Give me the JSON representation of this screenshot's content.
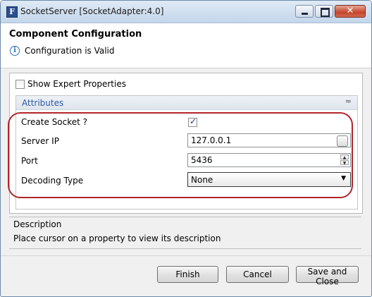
{
  "window": {
    "title": "SocketServer [SocketAdapter:4.0]",
    "app_icon_letter": "F",
    "controls": {
      "minimize": "minimize",
      "maximize": "maximize",
      "close": "✕"
    }
  },
  "header": {
    "title": "Component Configuration",
    "status": "Configuration is Valid",
    "info_icon": "i"
  },
  "config": {
    "show_expert_label": "Show Expert Properties",
    "show_expert_checked": false,
    "attributes": {
      "title": "Attributes",
      "collapse_icon": "≈",
      "rows": [
        {
          "label": "Create Socket ?",
          "type": "checkbox",
          "checked": true,
          "mark": "✓"
        },
        {
          "label": "Server IP",
          "type": "text",
          "value": "127.0.0.1"
        },
        {
          "label": "Port",
          "type": "spinner",
          "value": "5436"
        },
        {
          "label": "Decoding Type",
          "type": "select",
          "value": "None"
        }
      ]
    },
    "highlight_color": "#b0252b"
  },
  "description": {
    "title": "Description",
    "text": "Place cursor on a property to view its description"
  },
  "buttons": {
    "finish": "Finish",
    "cancel": "Cancel",
    "save_close": "Save and Close"
  }
}
